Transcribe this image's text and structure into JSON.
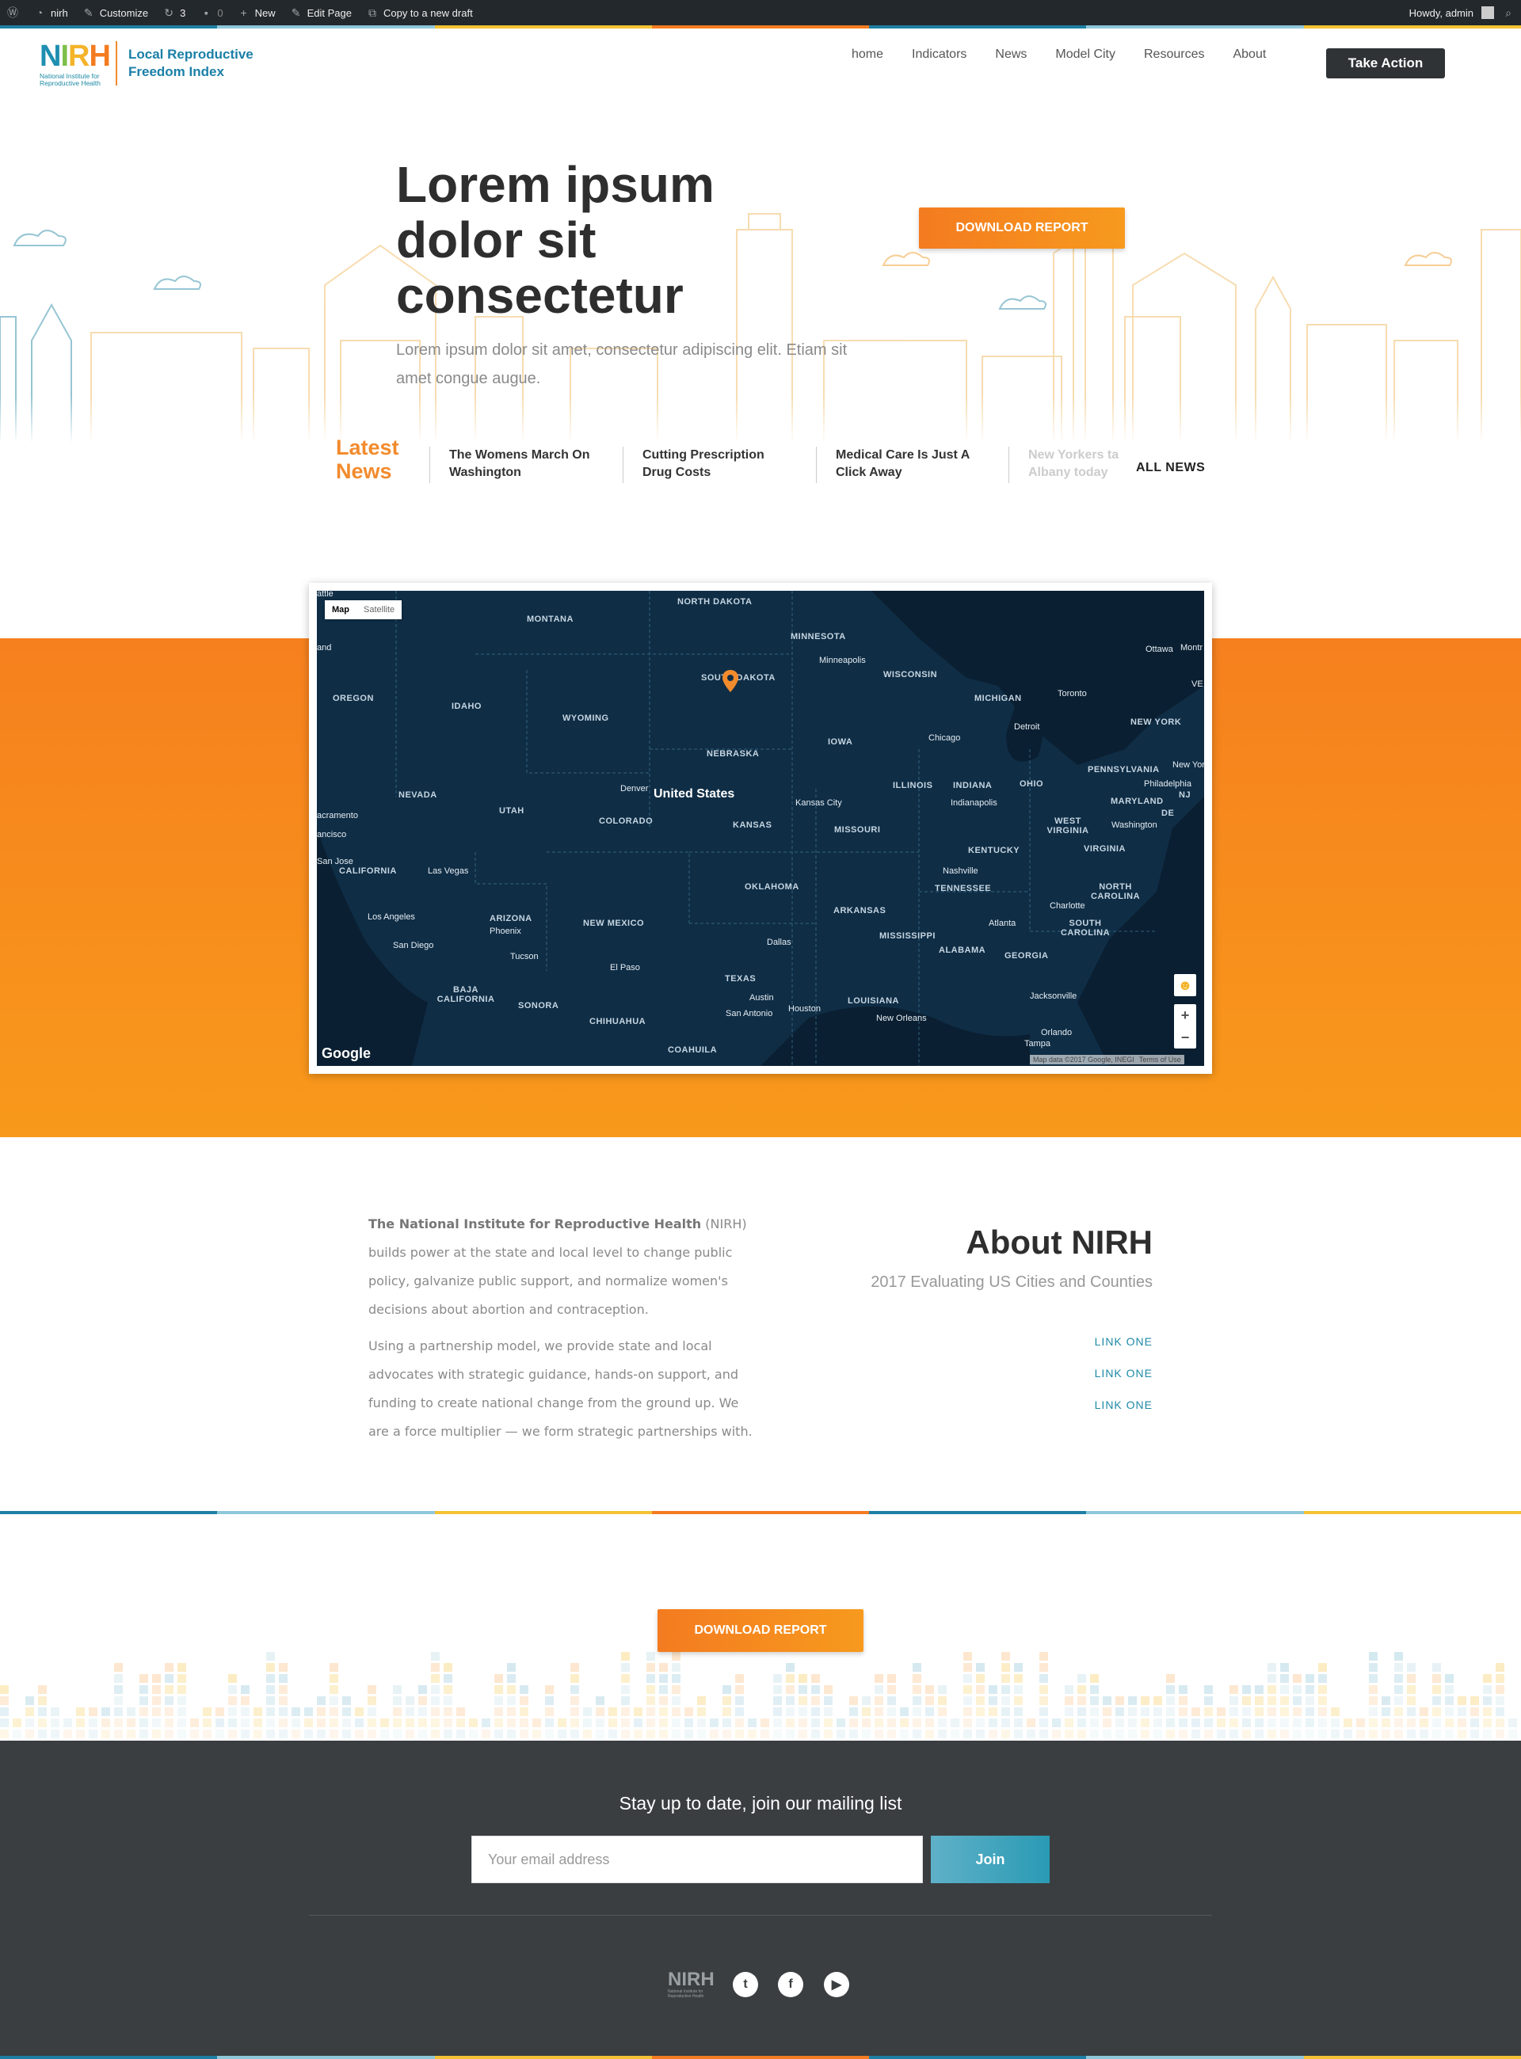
{
  "admin_bar": {
    "site_name": "nirh",
    "customize": "Customize",
    "updates_count": "3",
    "comments_count": "0",
    "new": "New",
    "edit_page": "Edit Page",
    "copy_draft": "Copy to a new draft",
    "howdy": "Howdy, admin"
  },
  "header": {
    "logo_letters": "NIRH",
    "logo_subtitle": "National Institute for Reproductive Health",
    "site_title_line1": "Local Reproductive",
    "site_title_line2": "Freedom Index",
    "nav": [
      "home",
      "Indicators",
      "News",
      "Model City",
      "Resources",
      "About"
    ],
    "cta": "Take Action"
  },
  "hero": {
    "title": "Lorem ipsum dolor sit consectetur",
    "subtitle": "Lorem ipsum dolor sit amet, consectetur adipiscing elit. Etiam sit amet congue augue.",
    "download_button": "DOWNLOAD REPORT"
  },
  "news": {
    "heading_line1": "Latest",
    "heading_line2": "News",
    "items": [
      {
        "line1": "The Womens March On",
        "line2": "Washington"
      },
      {
        "line1": "Cutting Prescription",
        "line2": "Drug Costs"
      },
      {
        "line1": "Medical Care Is Just A",
        "line2": "Click Away"
      },
      {
        "line1": "New Yorkers ta",
        "line2": "Albany today"
      }
    ],
    "all_news": "ALL NEWS"
  },
  "map": {
    "toggle_map": "Map",
    "toggle_satellite": "Satellite",
    "country_label": "United States",
    "states": [
      "NORTH DAKOTA",
      "MONTANA",
      "MINNESOTA",
      "SOUTH DAKOTA",
      "WISCONSIN",
      "MICHIGAN",
      "OREGON",
      "IDAHO",
      "WYOMING",
      "NEBRASKA",
      "IOWA",
      "NEW YORK",
      "PENNSYLVANIA",
      "NEVADA",
      "UTAH",
      "COLORADO",
      "KANSAS",
      "MISSOURI",
      "ILLINOIS",
      "INDIANA",
      "OHIO",
      "MARYLAND",
      "NJ",
      "DE",
      "WEST VIRGINIA",
      "VIRGINIA",
      "KENTUCKY",
      "CALIFORNIA",
      "TENNESSEE",
      "NORTH CAROLINA",
      "OKLAHOMA",
      "ARKANSAS",
      "SOUTH CAROLINA",
      "ARIZONA",
      "NEW MEXICO",
      "MISSISSIPPI",
      "ALABAMA",
      "GEORGIA",
      "TEXAS",
      "LOUISIANA",
      "BAJA CALIFORNIA",
      "SONORA",
      "CHIHUAHUA",
      "COAHUILA"
    ],
    "cities": [
      "Minneapolis",
      "Ottawa",
      "Montr",
      "Toronto",
      "Detroit",
      "Chicago",
      "Denver",
      "Kansas City",
      "Indianapolis",
      "New York",
      "Philadelphia",
      "Washington",
      "Nashville",
      "Charlotte",
      "Atlanta",
      "Las Vegas",
      "Los Angeles",
      "San Diego",
      "Phoenix",
      "Tucson",
      "El Paso",
      "Dallas",
      "Austin",
      "San Antonio",
      "Houston",
      "New Orleans",
      "Jacksonville",
      "Orlando",
      "Tampa",
      "San Jose",
      "acramento",
      "ancisco",
      "and",
      "attle",
      "VE"
    ],
    "attribution": "Map data ©2017 Google, INEGI",
    "terms": "Terms of Use",
    "google": "Google",
    "zoom_in": "+",
    "zoom_out": "−"
  },
  "about": {
    "org_name": "The National Institute for Reproductive Health",
    "para1_rest": " (NIRH) builds power at the state and local level to change public policy, galvanize public support, and normalize women's decisions about abortion and contraception.",
    "para2": "Using a partnership model, we provide state and local advocates with strategic guidance, hands-on support, and funding to create national change from the ground up. We are a force multiplier — we form strategic partnerships with.",
    "title": "About NIRH",
    "subtitle": "2017 Evaluating US Cities and Counties",
    "links": [
      "LINK ONE",
      "LINK ONE",
      "LINK ONE"
    ]
  },
  "download2": "DOWNLOAD REPORT",
  "footer": {
    "mailing_title": "Stay up to date, join our mailing list",
    "email_placeholder": "Your email address",
    "join": "Join",
    "logo_letters": "NIRH",
    "logo_sub": "National Institute for Reproductive Health",
    "socials": [
      "twitter-icon",
      "facebook-icon",
      "youtube-icon"
    ]
  },
  "colors": {
    "orange": "#f47b20",
    "teal": "#1d8aa5",
    "dark": "#3a3e41",
    "stripe": [
      "#1d7fa3",
      "#8fc7da",
      "#f4c233",
      "#f47b20",
      "#1d7fa3",
      "#8fc7da",
      "#f4c233"
    ]
  }
}
